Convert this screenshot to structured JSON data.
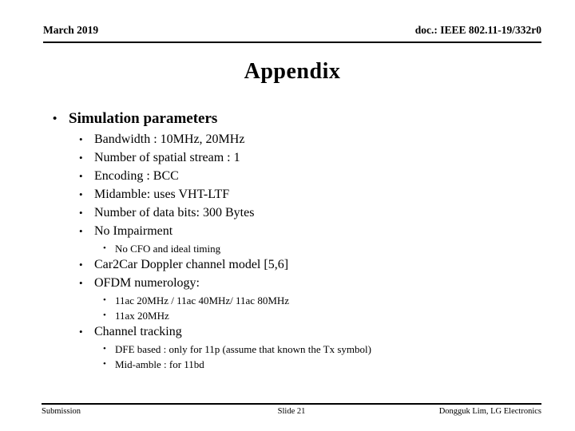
{
  "header": {
    "left": "March 2019",
    "right": "doc.: IEEE 802.11-19/332r0"
  },
  "title": "Appendix",
  "body": {
    "bullets": [
      {
        "level": 1,
        "marker": "•",
        "text": "Simulation parameters"
      },
      {
        "level": 2,
        "marker": "•",
        "text": "Bandwidth : 10MHz, 20MHz"
      },
      {
        "level": 2,
        "marker": "•",
        "text": "Number of spatial stream : 1"
      },
      {
        "level": 2,
        "marker": "•",
        "text": "Encoding : BCC"
      },
      {
        "level": 2,
        "marker": "•",
        "text": "Midamble: uses VHT-LTF"
      },
      {
        "level": 2,
        "marker": "•",
        "text": "Number of data bits: 300 Bytes"
      },
      {
        "level": 2,
        "marker": "•",
        "text": "No Impairment"
      },
      {
        "level": 3,
        "marker": "•",
        "text": "No CFO and ideal timing"
      },
      {
        "level": 2,
        "marker": "•",
        "text": "Car2Car Doppler channel model [5,6]"
      },
      {
        "level": 2,
        "marker": "•",
        "text": "OFDM numerology:"
      },
      {
        "level": 3,
        "marker": "•",
        "text": "11ac 20MHz / 11ac 40MHz/ 11ac 80MHz"
      },
      {
        "level": 3,
        "marker": "•",
        "text": "11ax 20MHz"
      },
      {
        "level": 2,
        "marker": "•",
        "text": "Channel tracking"
      },
      {
        "level": 3,
        "marker": "•",
        "text": "DFE based : only for 11p (assume that known the Tx symbol)"
      },
      {
        "level": 3,
        "marker": "•",
        "text": "Mid-amble : for 11bd"
      }
    ]
  },
  "footer": {
    "left": "Submission",
    "center": "Slide 21",
    "right": "Dongguk Lim, LG Electronics"
  },
  "colors": {
    "text": "#000000",
    "background": "#ffffff",
    "rule": "#000000"
  }
}
